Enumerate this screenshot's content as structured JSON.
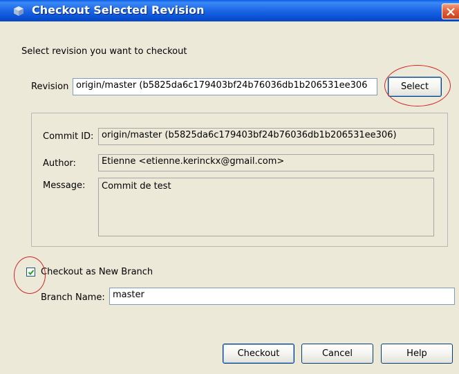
{
  "window": {
    "title": "Checkout Selected Revision"
  },
  "instructions": "Select revision you want to checkout",
  "revision": {
    "label": "Revision",
    "value": "origin/master (b5825da6c179403bf24b76036db1b206531ee306",
    "select_label": "Select"
  },
  "details": {
    "commit_id_label": "Commit ID:",
    "commit_id_value": "origin/master (b5825da6c179403bf24b76036db1b206531ee306)",
    "author_label": "Author:",
    "author_value": "Etienne <etienne.kerinckx@gmail.com>",
    "message_label": "Message:",
    "message_value": "Commit de test"
  },
  "new_branch": {
    "checkbox_label": "Checkout as New Branch",
    "checked": true,
    "branch_name_label": "Branch Name:",
    "branch_name_value": "master"
  },
  "buttons": {
    "checkout": "Checkout",
    "cancel": "Cancel",
    "help": "Help"
  },
  "colors": {
    "titlebar": "#0a5ee8",
    "window_bg": "#ece9d8",
    "annotation_circle": "#d42525",
    "checkmark": "#21a121"
  },
  "icons": {
    "title": "netbeans-cube-icon",
    "close": "close-icon",
    "check": "checkmark-icon"
  }
}
